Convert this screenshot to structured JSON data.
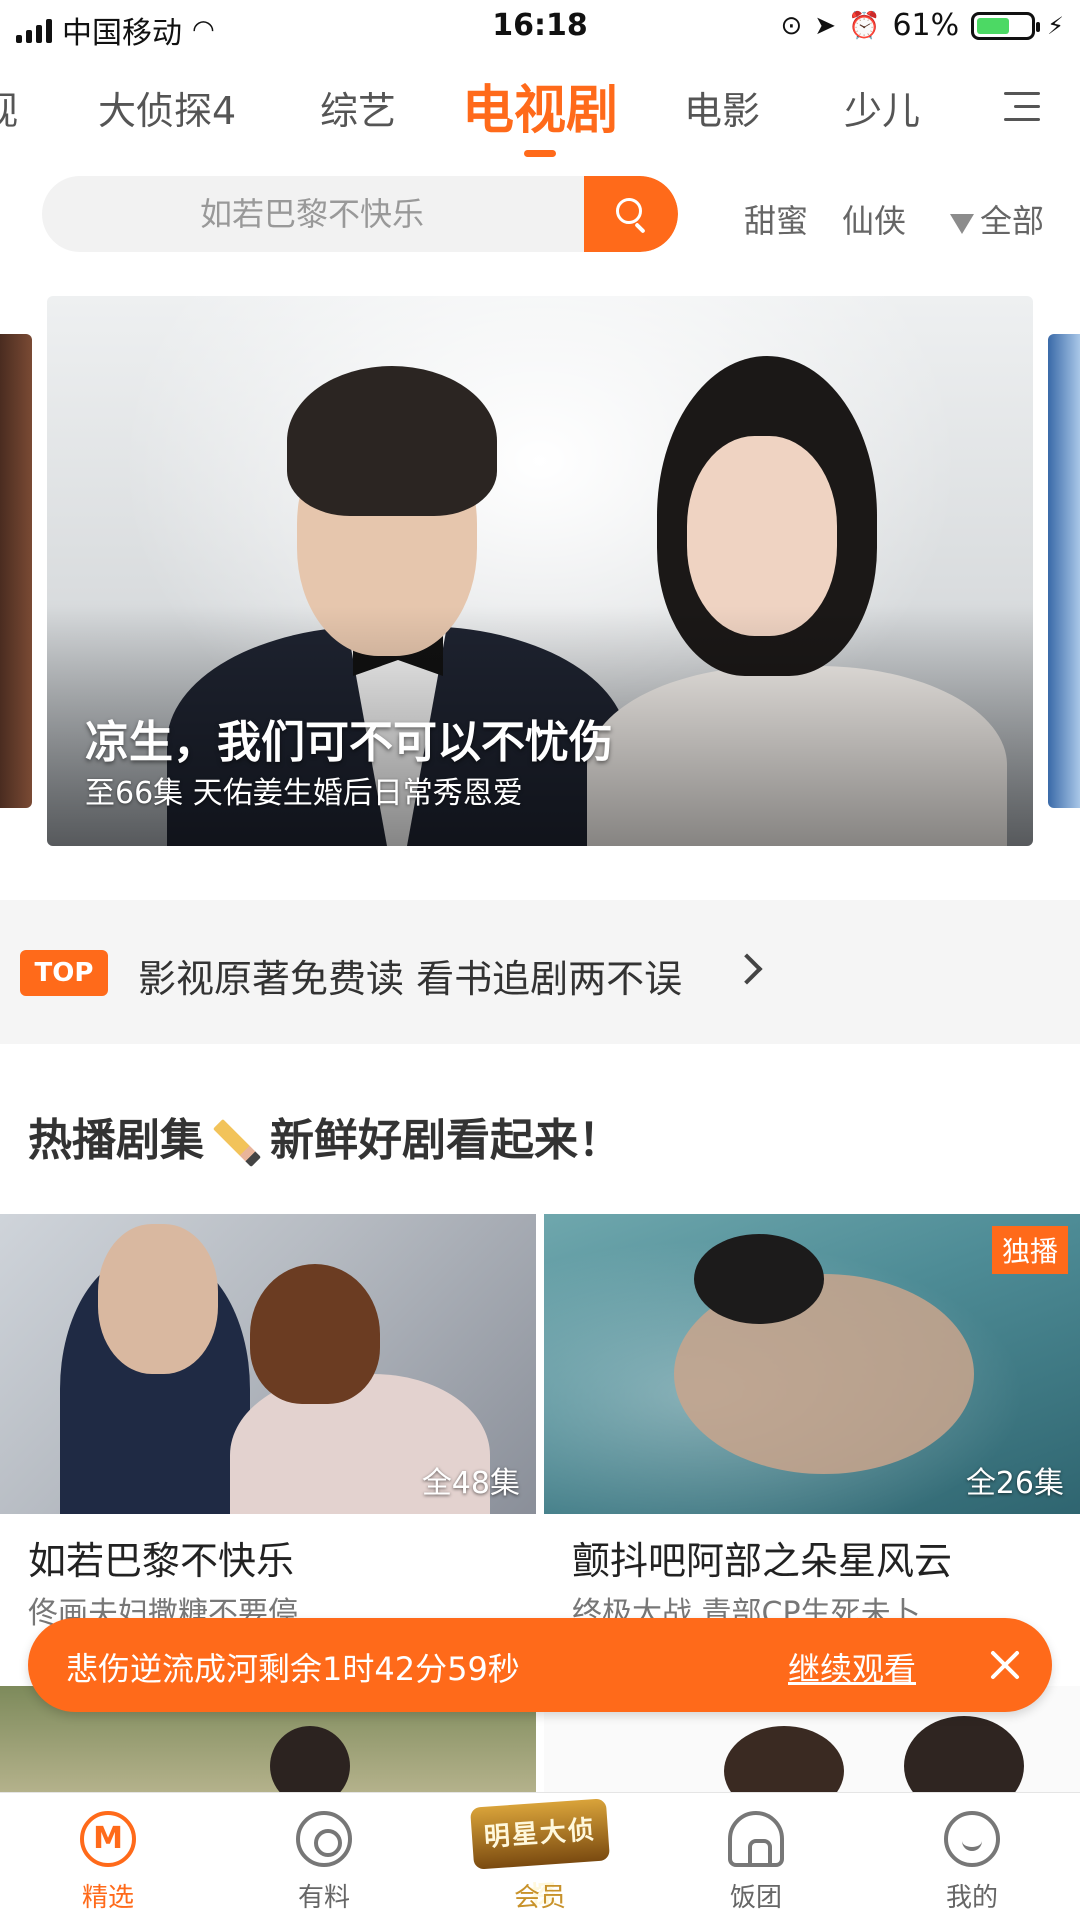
{
  "status_bar": {
    "carrier": "中国移动",
    "time": "16:18",
    "battery": "61%",
    "battery_level": 0.61
  },
  "tabs": {
    "items": [
      {
        "label": "视"
      },
      {
        "label": "大侦探4"
      },
      {
        "label": "综艺"
      },
      {
        "label": "电视剧"
      },
      {
        "label": "电影"
      },
      {
        "label": "少儿"
      }
    ],
    "active_index": 3
  },
  "search": {
    "placeholder": "如若巴黎不快乐",
    "filters": [
      "甜蜜",
      "仙侠",
      "全部"
    ]
  },
  "banner": {
    "title": "凉生，我们可不可以不忧伤",
    "subtitle": "至66集 天佑姜生婚后日常秀恩爱"
  },
  "top_strip": {
    "badge": "TOP",
    "text": "影视原著免费读 看书追剧两不误"
  },
  "section": {
    "title_a": "热播剧集",
    "title_b": "新鲜好剧看起来！"
  },
  "cards": [
    {
      "title": "如若巴黎不快乐",
      "subtitle": "佟画夫妇撒糖不要停",
      "episodes": "全48集",
      "badge": ""
    },
    {
      "title": "颤抖吧阿部之朵星风云",
      "subtitle": "终极大战 青部CP生死未卜",
      "episodes": "全26集",
      "badge": "独播"
    }
  ],
  "continue_watching": {
    "text": "悲伤逆流成河剩余1时42分59秒",
    "action": "继续观看"
  },
  "bottom_nav": {
    "items": [
      {
        "label": "精选",
        "icon": "home-icon"
      },
      {
        "label": "有料",
        "icon": "news-icon"
      },
      {
        "label": "会员",
        "icon": "vip-logo"
      },
      {
        "label": "饭团",
        "icon": "group-icon"
      },
      {
        "label": "我的",
        "icon": "profile-icon"
      }
    ],
    "active_index": 0
  },
  "colors": {
    "accent": "#ff6a1a"
  }
}
